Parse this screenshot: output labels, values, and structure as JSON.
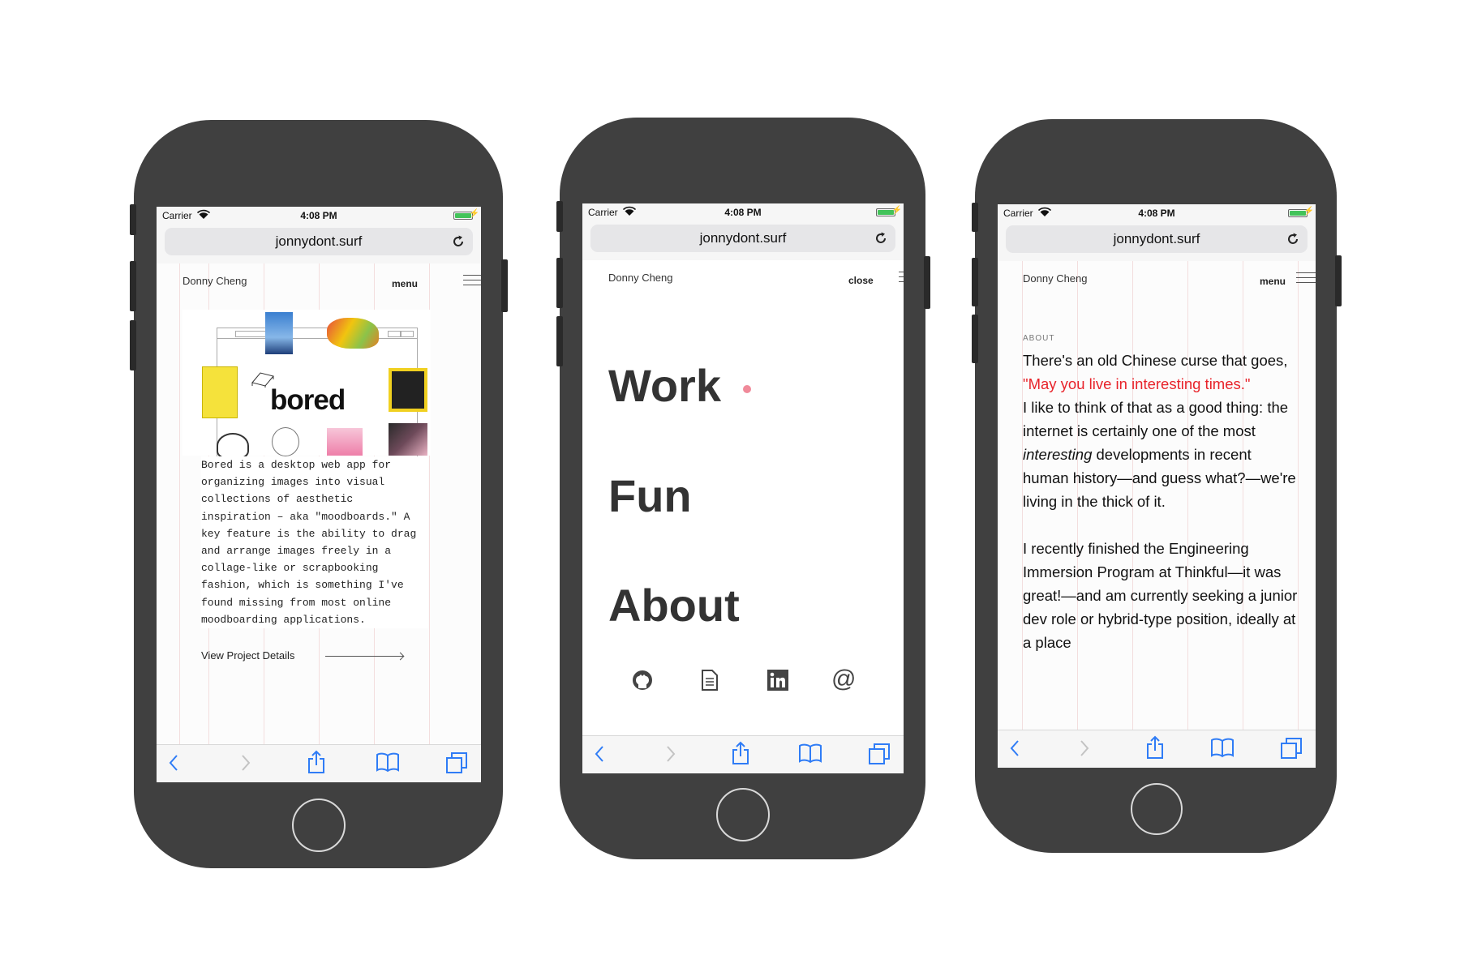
{
  "status": {
    "carrier": "Carrier",
    "time": "4:08 PM"
  },
  "browser": {
    "url": "jonnydont.surf"
  },
  "site": {
    "name": "Donny Cheng",
    "menu": "menu",
    "close": "close"
  },
  "phone1": {
    "logo": "bored",
    "description": "Bored is a desktop web app for organizing images into visual collections of aesthetic inspiration – aka \"moodboards.\" A key feature is the ability to drag and arrange images freely in a collage-like or scrapbooking fashion, which is something I've found missing from most online moodboarding applications.",
    "link": "View Project Details"
  },
  "phone2": {
    "nav": [
      "Work",
      "Fun",
      "About"
    ],
    "active_dot_color": "#f08a9a",
    "social_icons": [
      "github-icon",
      "document-icon",
      "linkedin-icon",
      "at-sign-icon"
    ]
  },
  "phone3": {
    "section_label": "ABOUT",
    "p1_pre": "There's an old Chinese curse that goes, ",
    "p1_quote": "\"May you live in interesting times.\"",
    "p2_pre": "I like to think of that as a good thing: the internet is certainly one of the most ",
    "p2_em": "interesting",
    "p2_post": " developments in recent human history—and guess what?—we're living in the thick of it.",
    "p3": "I recently finished the Engineering Immersion Program at Thinkful—it was great!—and am currently seeking a junior dev role or hybrid-type position, ideally at a place",
    "highlight_color": "#e8232a"
  }
}
